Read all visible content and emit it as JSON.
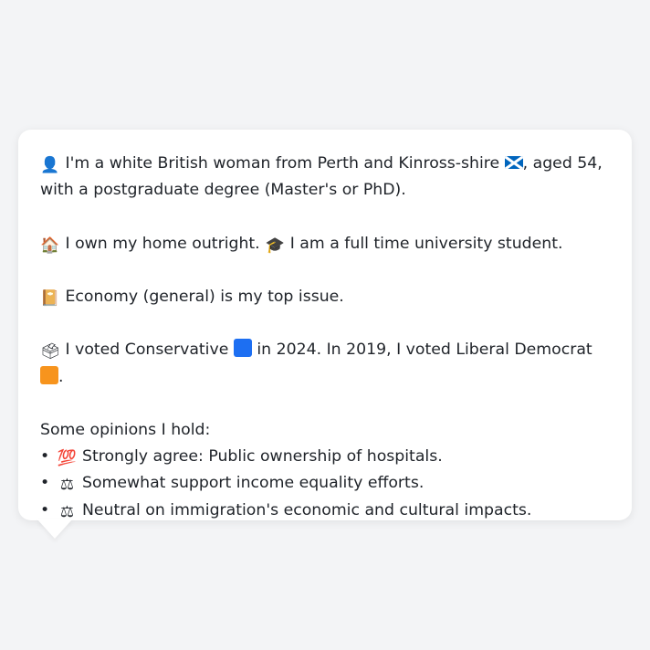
{
  "persona": {
    "identity": {
      "icon": "person-silhouette-icon",
      "icon_glyph": "👤",
      "text_a": "I'm a white British woman from Perth and Kinross-shire",
      "flag_icon": "scotland-flag-icon",
      "text_b": ", aged 54, with a postgraduate degree (Master's or PhD)."
    },
    "housing": {
      "icon": "house-icon",
      "icon_glyph": "🏠",
      "text_a": "I own my home outright.",
      "occupation_icon": "graduation-cap-icon",
      "occupation_glyph": "🎓",
      "text_b": "I am a full time university student."
    },
    "issue": {
      "icon": "ledger-icon",
      "icon_glyph": "📔",
      "text": "Economy (general) is my top issue."
    },
    "vote": {
      "icon": "ballot-box-icon",
      "icon_glyph": "🗳",
      "text_a": "I voted Conservative",
      "party_2024_icon": "blue-square-icon",
      "party_2024_color": "#1d6ff2",
      "text_b": "in 2024. In 2019, I voted Liberal Democrat",
      "party_2019_icon": "orange-square-icon",
      "party_2019_color": "#f7941d",
      "text_c": "."
    },
    "opinions": {
      "heading": "Some opinions I hold:",
      "bullet": "•",
      "items": [
        {
          "icon": "hundred-points-icon",
          "glyph": "💯",
          "text": "Strongly agree: Public ownership of hospitals."
        },
        {
          "icon": "balance-scale-icon",
          "glyph": "⚖",
          "text": "Somewhat support income equality efforts."
        },
        {
          "icon": "balance-scale-icon",
          "glyph": "⚖",
          "text": "Neutral on immigration's economic and cultural impacts."
        }
      ]
    }
  }
}
